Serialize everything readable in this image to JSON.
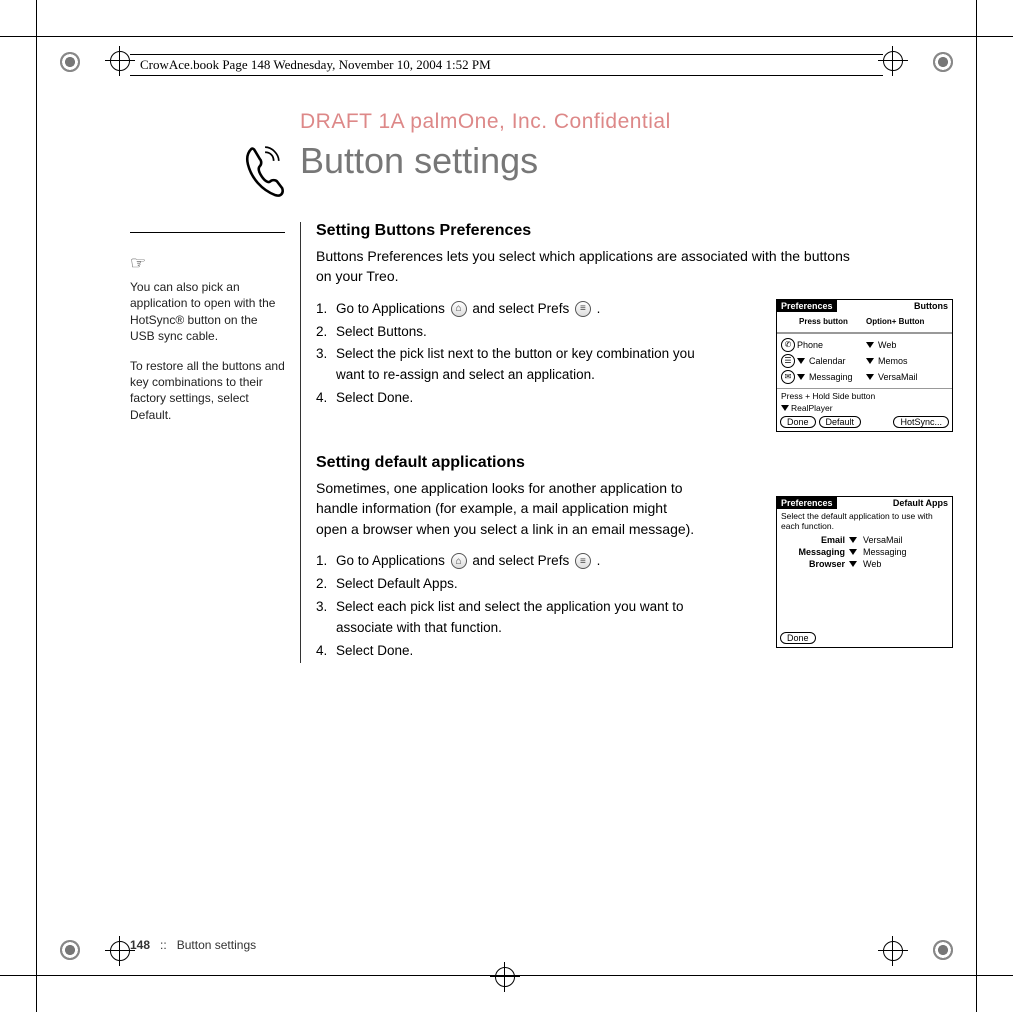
{
  "header_text": "CrowAce.book  Page 148  Wednesday, November 10, 2004  1:52 PM",
  "watermark": "DRAFT 1A  palmOne, Inc.   Confidential",
  "title": "Button settings",
  "sidebar": {
    "tip1": "You can also pick an application to open with the HotSync® button on the USB sync cable.",
    "tip2": "To restore all the buttons and key combinations to their factory settings, select Default."
  },
  "section1": {
    "heading": "Setting Buttons Preferences",
    "intro": "Buttons Preferences lets you select which applications are associated with the buttons on your Treo.",
    "steps": [
      {
        "n": "1.",
        "pre": "Go to Applications ",
        "mid": " and select Prefs ",
        "post": "."
      },
      {
        "n": "2.",
        "txt": "Select Buttons."
      },
      {
        "n": "3.",
        "txt": "Select the pick list next to the button or key combination you want to re-assign and select an application."
      },
      {
        "n": "4.",
        "txt": "Select Done."
      }
    ]
  },
  "section2": {
    "heading": "Setting default applications",
    "intro": "Sometimes, one application looks for another application to handle information (for example, a mail application might open a browser when you select a link in an email message).",
    "steps": [
      {
        "n": "1.",
        "pre": "Go to Applications ",
        "mid": " and select Prefs ",
        "post": "."
      },
      {
        "n": "2.",
        "txt": "Select Default Apps."
      },
      {
        "n": "3.",
        "txt": "Select each pick list and select the application you want to associate with that function."
      },
      {
        "n": "4.",
        "txt": "Select Done."
      }
    ]
  },
  "screenshot1": {
    "title_l": "Preferences",
    "title_r": "Buttons",
    "hdr_l": "Press button",
    "hdr_r": "Option+ Button",
    "rows": [
      {
        "icon": "phone",
        "l": "Phone",
        "r": "Web"
      },
      {
        "icon": "cal",
        "l": "Calendar",
        "r": "Memos"
      },
      {
        "icon": "msg",
        "l": "Messaging",
        "r": "VersaMail"
      }
    ],
    "side_label": "Press + Hold Side button",
    "side_val": "RealPlayer",
    "btns": [
      "Done",
      "Default",
      "HotSync..."
    ]
  },
  "screenshot2": {
    "title_l": "Preferences",
    "title_r": "Default Apps",
    "intro": "Select the default application to use with each function.",
    "rows": [
      {
        "l": "Email",
        "r": "VersaMail"
      },
      {
        "l": "Messaging",
        "r": "Messaging"
      },
      {
        "l": "Browser",
        "r": "Web"
      }
    ],
    "btn": "Done"
  },
  "footer": {
    "page": "148",
    "sep": "::",
    "title": "Button settings"
  }
}
